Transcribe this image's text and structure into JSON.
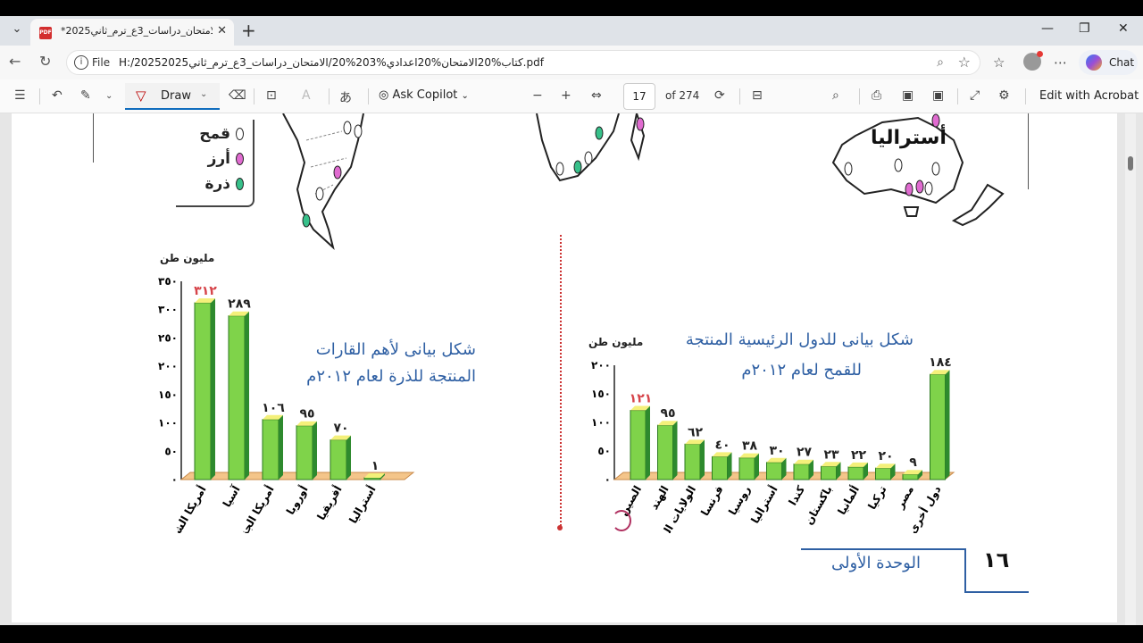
{
  "browser": {
    "tab_title": "*الامتحان_دراسات_3ع_ترم_ثاني2025",
    "tab_close": "✕",
    "new_tab": "+",
    "window": {
      "minimize": "—",
      "restore": "❐",
      "close": "✕"
    },
    "file_label": "File",
    "url": "H:/2025كتاب%20الامتحان%20اعدادي%203%20/الامتحان_دراسات_3ع_ترم_ثاني2025.pdf",
    "chat_label": "Chat"
  },
  "pdf_toolbar": {
    "draw_label": "Draw",
    "ask_copilot_label": "Ask Copilot",
    "page_number": "17",
    "page_total": "of 274",
    "edit_acrobat_label": "Edit with Acrobat"
  },
  "map": {
    "legend": [
      {
        "label": "قمح",
        "color": "#ffffff"
      },
      {
        "label": "أرز",
        "color": "#e06bd0"
      },
      {
        "label": "ذرة",
        "color": "#37c08a"
      }
    ],
    "australia_label": "أستراليا"
  },
  "chart_corn": {
    "title_line1": "شكل بيانى لأهم القارات",
    "title_line2": "المنتجة للذرة لعام ٢٠١٢م",
    "unit": "مليون طن",
    "yticks": [
      "٣٥٠",
      "٣٠٠",
      "٢٥٠",
      "٢٠٠",
      "١٥٠",
      "١٠٠",
      "٥٠",
      "٠"
    ],
    "value_labels": [
      "٣١٢",
      "٢٨٩",
      "١٠٦",
      "٩٥",
      "٧٠",
      "١"
    ],
    "categories": [
      "أمريكا الشمالية",
      "آسيا",
      "أمريكا الجنوبية",
      "أوروبا",
      "أفريقيا",
      "أستراليا"
    ]
  },
  "chart_wheat": {
    "title_line1": "شكل بيانى للدول الرئيسية المنتجة",
    "title_line2": "للقمح لعام ٢٠١٢م",
    "unit": "مليون طن",
    "yticks": [
      "٢٠٠",
      "١٥٠",
      "١٠٠",
      "٥٠",
      "٠"
    ],
    "value_labels": [
      "١٢١",
      "٩٥",
      "٦٢",
      "٤٠",
      "٣٨",
      "٣٠",
      "٢٧",
      "٢٣",
      "٢٢",
      "٢٠",
      "٩",
      "١٨٤"
    ],
    "categories": [
      "الصين",
      "الهند",
      "الولايات المتحدة",
      "فرنسا",
      "روسيا",
      "أستراليا",
      "كندا",
      "باكستان",
      "ألمانيا",
      "تركيا",
      "مصر",
      "دول أخرى"
    ]
  },
  "footer": {
    "unit_label": "الوحدة الأولى",
    "page_number": "١٦"
  },
  "chart_data": [
    {
      "type": "bar",
      "title": "شكل بيانى لأهم القارات المنتجة للذرة لعام ٢٠١٢م",
      "ylabel": "مليون طن",
      "categories": [
        "أمريكا الشمالية",
        "آسيا",
        "أمريكا الجنوبية",
        "أوروبا",
        "أفريقيا",
        "أستراليا"
      ],
      "values": [
        312,
        289,
        106,
        95,
        70,
        1
      ],
      "ylim": [
        0,
        350
      ],
      "colors": {
        "bar": "#7fd34a",
        "value_label_first": "#d6444a"
      }
    },
    {
      "type": "bar",
      "title": "شكل بيانى للدول الرئيسية المنتجة للقمح لعام ٢٠١٢م",
      "ylabel": "مليون طن",
      "categories": [
        "الصين",
        "الهند",
        "الولايات المتحدة",
        "فرنسا",
        "روسيا",
        "أستراليا",
        "كندا",
        "باكستان",
        "ألمانيا",
        "تركيا",
        "مصر",
        "دول أخرى"
      ],
      "values": [
        121,
        95,
        62,
        40,
        38,
        30,
        27,
        23,
        22,
        20,
        9,
        184
      ],
      "ylim": [
        0,
        200
      ],
      "colors": {
        "bar": "#7fd34a",
        "value_label_first": "#d6444a"
      }
    }
  ]
}
